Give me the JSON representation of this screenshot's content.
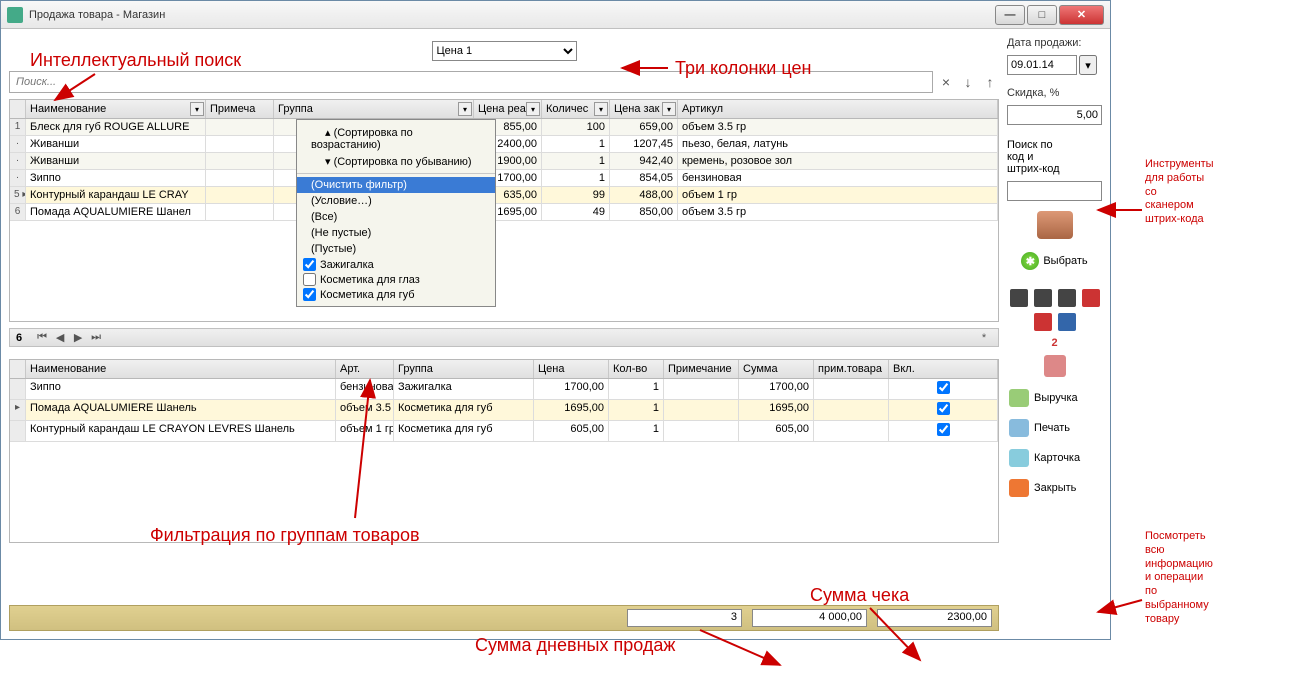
{
  "window": {
    "title": "Продажа товара - Магазин"
  },
  "price": {
    "selected": "Цена 1"
  },
  "search": {
    "placeholder": "Поиск..."
  },
  "grid1": {
    "headers": [
      "Наименование",
      "Примеча",
      "Группа",
      "Цена реа",
      "Количес",
      "Цена зак",
      "Артикул"
    ],
    "rows": [
      {
        "n": "1",
        "name": "Блеск для губ ROUGE ALLURE",
        "note": "",
        "group": "",
        "price": "855,00",
        "qty": "100",
        "cost": "659,00",
        "art": "объем 3.5 гр"
      },
      {
        "n": "·",
        "name": "Живанши",
        "note": "",
        "group": "",
        "price": "2400,00",
        "qty": "1",
        "cost": "1207,45",
        "art": "пьезо, белая, латунь"
      },
      {
        "n": "·",
        "name": "Живанши",
        "note": "",
        "group": "",
        "price": "1900,00",
        "qty": "1",
        "cost": "942,40",
        "art": "кремень, розовое зол"
      },
      {
        "n": "·",
        "name": "Зиппо",
        "note": "",
        "group": "",
        "price": "1700,00",
        "qty": "1",
        "cost": "854,05",
        "art": "бензиновая"
      },
      {
        "n": "5 ▸",
        "name": "Контурный карандаш LE CRAY",
        "note": "",
        "group": "",
        "price": "635,00",
        "qty": "99",
        "cost": "488,00",
        "art": "объем 1 гр",
        "hl": true
      },
      {
        "n": "6",
        "name": "Помада AQUALUMIERE Шанел",
        "note": "",
        "group": "",
        "price": "1695,00",
        "qty": "49",
        "cost": "850,00",
        "art": "объем 3.5 гр"
      }
    ],
    "count": "6"
  },
  "filter": {
    "sort_asc": "(Сортировка по возрастанию)",
    "sort_desc": "(Сортировка по убыванию)",
    "clear": "(Очистить фильтр)",
    "cond": "(Условие…)",
    "all": "(Все)",
    "nonempty": "(Не пустые)",
    "empty": "(Пустые)",
    "checks": [
      {
        "label": "Зажигалка",
        "checked": true
      },
      {
        "label": "Косметика для глаз",
        "checked": false
      },
      {
        "label": "Косметика для губ",
        "checked": true
      }
    ]
  },
  "grid2": {
    "headers": [
      "Наименование",
      "Арт.",
      "Группа",
      "Цена",
      "Кол-во",
      "Примечание",
      "Сумма",
      "прим.товара",
      "Вкл."
    ],
    "rows": [
      {
        "name": "Зиппо",
        "art": "бензинова",
        "group": "Зажигалка",
        "price": "1700,00",
        "qty": "1",
        "note": "",
        "sum": "1700,00",
        "pt": "",
        "on": true
      },
      {
        "name": "Помада AQUALUMIERE Шанель",
        "art": "объем 3.5",
        "group": "Косметика для губ",
        "price": "1695,00",
        "qty": "1",
        "note": "",
        "sum": "1695,00",
        "pt": "",
        "on": true,
        "hl": true
      },
      {
        "name": "Контурный карандаш LE CRAYON LEVRES Шанель",
        "art": "объем 1 гр",
        "group": "Косметика для губ",
        "price": "605,00",
        "qty": "1",
        "note": "",
        "sum": "605,00",
        "pt": "",
        "on": true
      }
    ]
  },
  "totals": {
    "count": "3",
    "day": "4 000,00",
    "check": "2300,00"
  },
  "side": {
    "date_label": "Дата продажи:",
    "date": "09.01.14",
    "discount_label": "Скидка, %",
    "discount": "5,00",
    "barcode_label1": "Поиск по",
    "barcode_label2": "код и",
    "barcode_label3": "штрих-код",
    "pick": "Выбрать",
    "counter": "2",
    "revenue": "Выручка",
    "print": "Печать",
    "card": "Карточка",
    "close": "Закрыть"
  },
  "annotations": {
    "a1": "Интеллектуальный поиск",
    "a2": "Три колонки цен",
    "a3": "Фильтрация по группам товаров",
    "a4": "Сумма дневных продаж",
    "a5": "Сумма чека",
    "a6": "Инструменты",
    "a6b": "для работы",
    "a6c": "со",
    "a6d": "сканером",
    "a6e": "штрих-кода",
    "a7": "Посмотреть",
    "a7b": "всю",
    "a7c": "информацию",
    "a7d": "и операции",
    "a7e": "по",
    "a7f": "выбранному",
    "a7g": "товару"
  }
}
